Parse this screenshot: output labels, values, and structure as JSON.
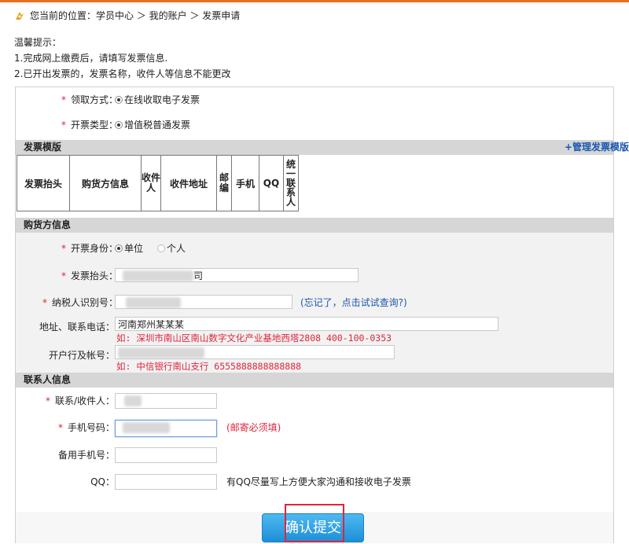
{
  "breadcrumb": {
    "text": "您当前的位置：学员中心 ＞ 我的账户 ＞ 发票申请"
  },
  "tips": {
    "title": "温馨提示：",
    "line1": "1.完成网上缴费后，请填写发票信息.",
    "line2": "2.已开出发票的，发票名称，收件人等信息不能更改"
  },
  "receive": {
    "label": "领取方式：",
    "option": "在线收取电子发票"
  },
  "invoice_type": {
    "label": "开票类型：",
    "option": "增值税普通发票"
  },
  "template": {
    "title": "发票模版",
    "manage": "+管理发票模版",
    "columns": [
      "发票抬头",
      "购货方信息",
      "收件人",
      "收件地址",
      "邮编",
      "手机",
      "QQ",
      "统一联系人"
    ]
  },
  "buyer": {
    "title": "购货方信息",
    "identity": {
      "label": "开票身份：",
      "opt1": "单位",
      "opt2": "个人"
    },
    "header": {
      "label": "发票抬头：",
      "value_end": "司"
    },
    "tax_id": {
      "label": "纳税人识别号：",
      "link": "(忘记了，点击试试查询?)"
    },
    "address": {
      "label": "地址、联系电话：",
      "value": "河南郑州某某某",
      "example": "如: 深圳市南山区南山数字文化产业基地西塔2808 400-100-0353"
    },
    "bank": {
      "label": "开户行及帐号：",
      "example": "如: 中信银行南山支行 6555888888888888"
    }
  },
  "contact": {
    "title": "联系人信息",
    "receiver": {
      "label": "联系/收件人："
    },
    "mobile": {
      "label": "手机号码：",
      "note": "(邮寄必须填)"
    },
    "backup_mobile": {
      "label": "备用手机号："
    },
    "qq": {
      "label": "QQ：",
      "note": "有QQ尽量写上方便大家沟通和接收电子发票"
    }
  },
  "submit": {
    "label": "确认提交"
  },
  "colors": {
    "accent": "#1d8fd8",
    "required": "#e0253b",
    "link": "#1a57b0"
  }
}
